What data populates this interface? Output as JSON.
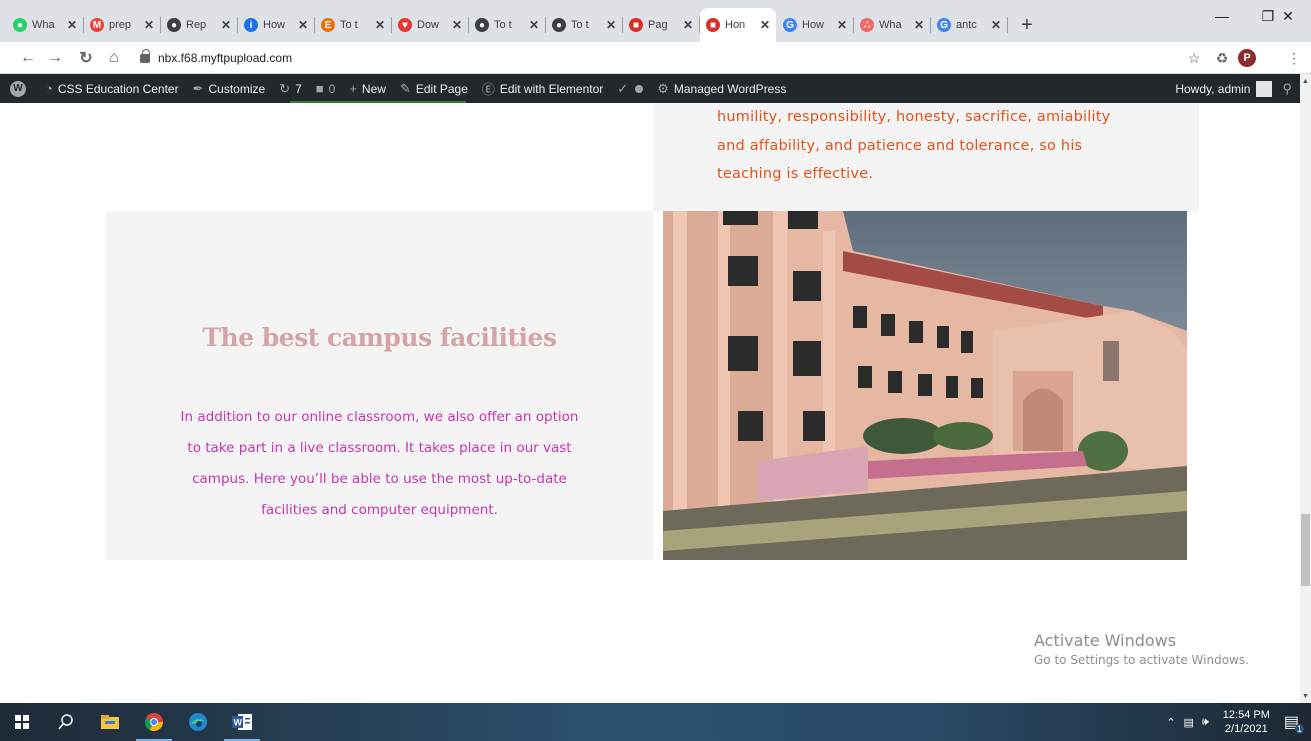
{
  "browser": {
    "tabs": [
      {
        "label": "Wha",
        "icon": "whatsapp-icon",
        "color": "#25d366",
        "glyph": "●"
      },
      {
        "label": "prep",
        "icon": "gmail-icon",
        "color": "#ea4335",
        "glyph": "M"
      },
      {
        "label": "Rep",
        "icon": "globe-icon",
        "color": "#3c4043",
        "glyph": "●"
      },
      {
        "label": "How",
        "icon": "info-icon",
        "color": "#1a73e8",
        "glyph": "i"
      },
      {
        "label": "To t",
        "icon": "elementor-e-icon",
        "color": "#e8710a",
        "glyph": "E"
      },
      {
        "label": "Dow",
        "icon": "heart-icon",
        "color": "#e53935",
        "glyph": "♥"
      },
      {
        "label": "To t",
        "icon": "globe-icon",
        "color": "#3c4043",
        "glyph": "●"
      },
      {
        "label": "To t",
        "icon": "globe-icon",
        "color": "#3c4043",
        "glyph": "●"
      },
      {
        "label": "Pag",
        "icon": "store-icon",
        "color": "#d93025",
        "glyph": "■"
      },
      {
        "label": "Hon",
        "icon": "store-icon",
        "color": "#d93025",
        "glyph": "■",
        "active": true
      },
      {
        "label": "How",
        "icon": "gp-icon",
        "color": "#4285f4",
        "glyph": "G"
      },
      {
        "label": "Wha",
        "icon": "asana-icon",
        "color": "#f06a6a",
        "glyph": "∴"
      },
      {
        "label": "antc",
        "icon": "google-icon",
        "color": "#4285f4",
        "glyph": "G"
      }
    ],
    "close_glyph": "✕",
    "new_tab_glyph": "+",
    "window_controls": {
      "minimize": "—",
      "restore": "❐",
      "close": "✕"
    },
    "url": "nbx.f68.myftpupload.com",
    "profile_initial": "P"
  },
  "wp_admin_bar": {
    "items": [
      {
        "label": "CSS Education Center",
        "icon": "dashboard-icon"
      },
      {
        "label": "Customize",
        "icon": "brush-icon"
      },
      {
        "label": "7",
        "icon": "updates-icon"
      },
      {
        "label": "0",
        "icon": "comments-icon"
      },
      {
        "label": "New",
        "icon": "plus-icon"
      },
      {
        "label": "Edit Page",
        "icon": "pencil-icon"
      },
      {
        "label": "Edit with Elementor",
        "icon": "elementor-icon"
      },
      {
        "label": "",
        "icon": "yoast-icon"
      },
      {
        "label": "Managed WordPress",
        "icon": "gear-icon"
      }
    ],
    "howdy": "Howdy, admin"
  },
  "page": {
    "top_text": "humility, responsibility, honesty, sacrifice, amiability and affability, and patience and tolerance, so his teaching is effective.",
    "heading": "The best campus facilities",
    "body": "In addition to our online classroom, we also offer an option to take part in a live classroom. It takes place in our vast campus. Here you’ll be able to use the most up-to-date facilities and computer equipment.",
    "colors": {
      "top_text": "#e0541b",
      "heading": "#d4a4a6",
      "body": "#c735b0",
      "box": "#f4f4f4"
    }
  },
  "watermark": {
    "line1": "Activate Windows",
    "line2": "Go to Settings to activate Windows."
  },
  "taskbar": {
    "time": "12:54 PM",
    "date": "2/1/2021",
    "notification_count": "1"
  }
}
